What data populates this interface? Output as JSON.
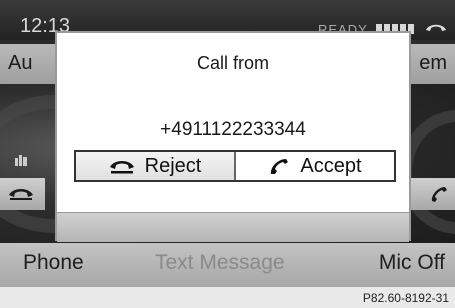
{
  "status_bar": {
    "time": "12:13",
    "status": "READY"
  },
  "menu_bar": {
    "left_item": "Au",
    "right_item": "em"
  },
  "dialog": {
    "title": "Call from",
    "caller_number": "+4911122233344",
    "reject_label": "Reject",
    "accept_label": "Accept"
  },
  "bottom_bar": {
    "phone_label": "Phone",
    "text_message_label": "Text Message",
    "mic_label": "Mic Off"
  },
  "caption": "P82.60-8192-31",
  "icons": [
    "phone-hangup-icon",
    "phone-accept-icon",
    "building-icon",
    "signal-bars-icon"
  ]
}
